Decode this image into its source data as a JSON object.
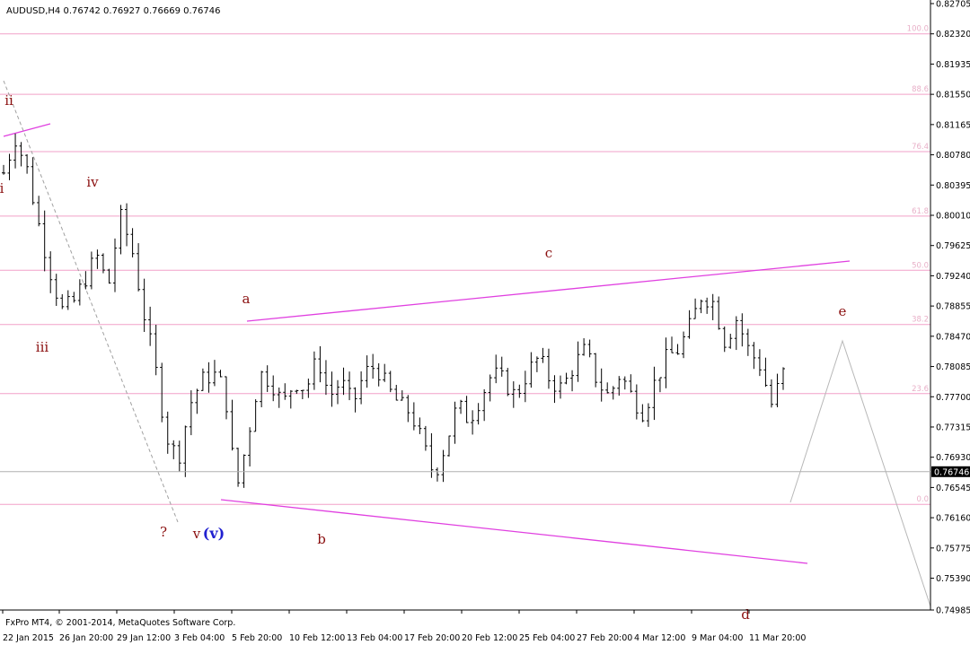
{
  "header": {
    "symbol": "AUDUSD,H4",
    "open": "0.76742",
    "high": "0.76927",
    "low": "0.76669",
    "close": "0.76746"
  },
  "footer": {
    "copyright": "FxPro MT4, © 2001-2014, MetaQuotes Software Corp."
  },
  "colors": {
    "candle": "#000000",
    "fib": "#f2a0c8",
    "fib_label": "#e8b0c8",
    "channel": "#e040e0",
    "wave_red": "#8b1010",
    "wave_teal": "#208080",
    "wave_blue": "#2020d0",
    "projection": "#b8b8b8",
    "current_price_line": "#b0b0b0"
  },
  "chart_data": {
    "type": "candlestick",
    "ylim": [
      0.74985,
      0.82705
    ],
    "y_ticks": [
      "0.82705",
      "0.82320",
      "0.81935",
      "0.81550",
      "0.81165",
      "0.80780",
      "0.80395",
      "0.80010",
      "0.79625",
      "0.79240",
      "0.78855",
      "0.78470",
      "0.78085",
      "0.77700",
      "0.77315",
      "0.76930",
      "0.76545",
      "0.76160",
      "0.75775",
      "0.75390",
      "0.74985"
    ],
    "current_price": "0.76746",
    "x_ticks": [
      "22 Jan 2015",
      "26 Jan 20:00",
      "29 Jan 12:00",
      "3 Feb 04:00",
      "5 Feb 20:00",
      "10 Feb 12:00",
      "13 Feb 04:00",
      "17 Feb 20:00",
      "20 Feb 12:00",
      "25 Feb 04:00",
      "27 Feb 20:00",
      "4 Mar 12:00",
      "9 Mar 04:00",
      "11 Mar 20:00"
    ],
    "bar_count": 134,
    "close_path": [
      [
        0,
        0.8055
      ],
      [
        2,
        0.81
      ],
      [
        4,
        0.806
      ],
      [
        6,
        0.799
      ],
      [
        8,
        0.793
      ],
      [
        10,
        0.788
      ],
      [
        12,
        0.789
      ],
      [
        14,
        0.792
      ],
      [
        16,
        0.795
      ],
      [
        18,
        0.791
      ],
      [
        20,
        0.8
      ],
      [
        22,
        0.796
      ],
      [
        24,
        0.788
      ],
      [
        26,
        0.781
      ],
      [
        28,
        0.772
      ],
      [
        30,
        0.769
      ],
      [
        32,
        0.776
      ],
      [
        34,
        0.779
      ],
      [
        36,
        0.78
      ],
      [
        38,
        0.778
      ],
      [
        40,
        0.765
      ],
      [
        42,
        0.772
      ],
      [
        44,
        0.78
      ],
      [
        46,
        0.779
      ],
      [
        48,
        0.776
      ],
      [
        50,
        0.779
      ],
      [
        52,
        0.778
      ],
      [
        54,
        0.782
      ],
      [
        56,
        0.777
      ],
      [
        58,
        0.779
      ],
      [
        60,
        0.776
      ],
      [
        62,
        0.78
      ],
      [
        64,
        0.781
      ],
      [
        66,
        0.778
      ],
      [
        68,
        0.776
      ],
      [
        70,
        0.775
      ],
      [
        72,
        0.771
      ],
      [
        74,
        0.767
      ],
      [
        76,
        0.771
      ],
      [
        78,
        0.776
      ],
      [
        80,
        0.774
      ],
      [
        82,
        0.777
      ],
      [
        84,
        0.78
      ],
      [
        86,
        0.779
      ],
      [
        88,
        0.777
      ],
      [
        90,
        0.78
      ],
      [
        92,
        0.782
      ],
      [
        94,
        0.779
      ],
      [
        96,
        0.778
      ],
      [
        98,
        0.781
      ],
      [
        100,
        0.783
      ],
      [
        102,
        0.779
      ],
      [
        104,
        0.777
      ],
      [
        106,
        0.78
      ],
      [
        108,
        0.777
      ],
      [
        110,
        0.775
      ],
      [
        112,
        0.779
      ],
      [
        114,
        0.782
      ],
      [
        116,
        0.783
      ],
      [
        118,
        0.786
      ],
      [
        120,
        0.79
      ],
      [
        122,
        0.789
      ],
      [
        124,
        0.784
      ],
      [
        126,
        0.787
      ],
      [
        128,
        0.783
      ],
      [
        130,
        0.781
      ],
      [
        132,
        0.776
      ],
      [
        134,
        0.78
      ]
    ],
    "close_path_scale": "bar index mapped to 0-134 grid",
    "fib_levels": [
      {
        "label": "100.0",
        "price": 0.8232
      },
      {
        "label": "88.6",
        "price": 0.8155
      },
      {
        "label": "76.4",
        "price": 0.8082
      },
      {
        "label": "61.8",
        "price": 0.8
      },
      {
        "label": "50.0",
        "price": 0.7931
      },
      {
        "label": "38.2",
        "price": 0.7862
      },
      {
        "label": "23.6",
        "price": 0.7774
      },
      {
        "label": "0.0",
        "price": 0.7633
      }
    ],
    "wave_labels": [
      {
        "text": "i",
        "color": "red"
      },
      {
        "text": "ii",
        "color": "red"
      },
      {
        "text": "iii",
        "color": "red"
      },
      {
        "text": "iv",
        "color": "red"
      },
      {
        "text": "v",
        "color": "red"
      },
      {
        "text": "(v)",
        "color": "blue"
      },
      {
        "text": "a",
        "color": "red"
      },
      {
        "text": "b",
        "color": "red"
      },
      {
        "text": "c",
        "color": "red"
      },
      {
        "text": "d",
        "color": "red"
      },
      {
        "text": "e",
        "color": "red"
      },
      {
        "text": "?",
        "color": "red"
      }
    ]
  }
}
